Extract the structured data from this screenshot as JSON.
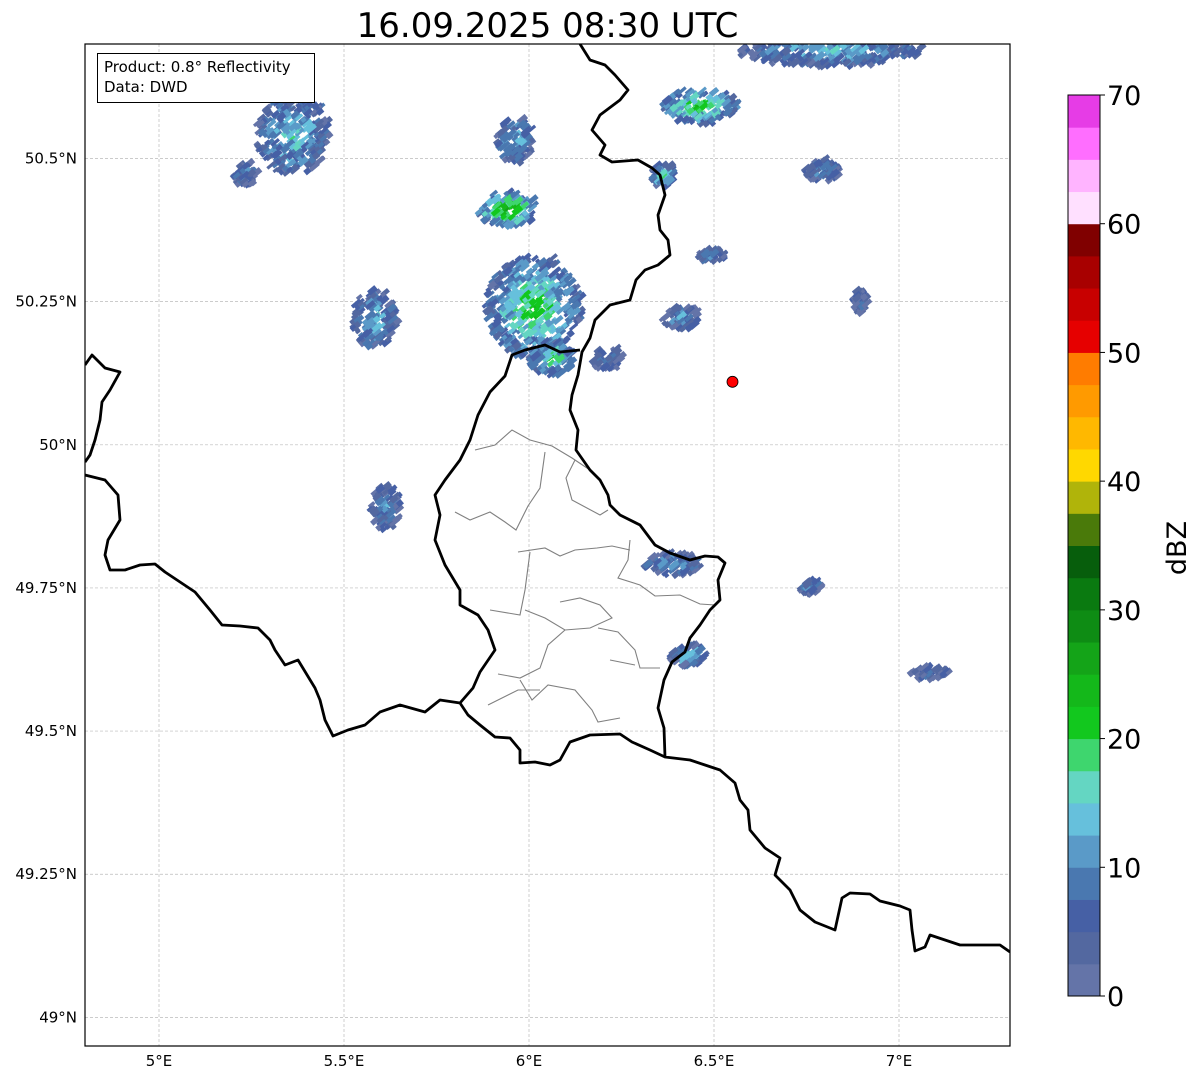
{
  "title": "16.09.2025 08:30 UTC",
  "info": {
    "product": "Product: 0.8° Reflectivity",
    "data_source": "Data: DWD"
  },
  "map": {
    "lon_range": [
      4.8,
      7.3
    ],
    "lat_range": [
      48.95,
      50.7
    ],
    "lat_ticks": [
      {
        "value": 50.5,
        "label": "50.5°N"
      },
      {
        "value": 50.25,
        "label": "50.25°N"
      },
      {
        "value": 50.0,
        "label": "50°N"
      },
      {
        "value": 49.75,
        "label": "49.75°N"
      },
      {
        "value": 49.5,
        "label": "49.5°N"
      },
      {
        "value": 49.25,
        "label": "49.25°N"
      },
      {
        "value": 49.0,
        "label": "49°N"
      }
    ],
    "lon_ticks": [
      {
        "value": 5.0,
        "label": "5°E"
      },
      {
        "value": 5.5,
        "label": "5.5°E"
      },
      {
        "value": 6.0,
        "label": "6°E"
      },
      {
        "value": 6.5,
        "label": "6.5°E"
      },
      {
        "value": 7.0,
        "label": "7°E"
      }
    ],
    "gridlines": true,
    "marker": {
      "lon": 6.55,
      "lat": 50.11,
      "color": "#ff0000"
    }
  },
  "colorbar": {
    "label": "dBZ",
    "min": 0,
    "max": 70,
    "ticks": [
      "0",
      "10",
      "20",
      "30",
      "40",
      "50",
      "60",
      "70"
    ],
    "colors": [
      "#6474a8",
      "#5368a0",
      "#4660a5",
      "#4a78b0",
      "#5a9ac8",
      "#66c0dc",
      "#64d6c2",
      "#3ed66e",
      "#12c81e",
      "#14b81a",
      "#14a418",
      "#0e8c14",
      "#0a7a10",
      "#075e0c",
      "#4a7a0a",
      "#b0b40a",
      "#ffd800",
      "#ffb800",
      "#ff9a00",
      "#ff7c00",
      "#e60000",
      "#c80000",
      "#a80000",
      "#800000",
      "#ffe0ff",
      "#ffb4ff",
      "#ff6eff",
      "#e63ce6"
    ]
  },
  "echoes": [
    {
      "lon": 6.0,
      "lat": 50.24,
      "rlon": 0.13,
      "rlat": 0.09,
      "dbz": 22
    },
    {
      "lon": 6.05,
      "lat": 50.15,
      "rlon": 0.06,
      "rlat": 0.03,
      "dbz": 20
    },
    {
      "lon": 5.93,
      "lat": 50.41,
      "rlon": 0.08,
      "rlat": 0.03,
      "dbz": 28
    },
    {
      "lon": 6.45,
      "lat": 50.59,
      "rlon": 0.1,
      "rlat": 0.03,
      "dbz": 24
    },
    {
      "lon": 5.35,
      "lat": 50.54,
      "rlon": 0.1,
      "rlat": 0.07,
      "dbz": 16
    },
    {
      "lon": 5.57,
      "lat": 50.22,
      "rlon": 0.06,
      "rlat": 0.05,
      "dbz": 14
    },
    {
      "lon": 5.95,
      "lat": 50.53,
      "rlon": 0.05,
      "rlat": 0.04,
      "dbz": 14
    },
    {
      "lon": 6.8,
      "lat": 50.69,
      "rlon": 0.25,
      "rlat": 0.03,
      "dbz": 14
    },
    {
      "lon": 6.42,
      "lat": 49.63,
      "rlon": 0.05,
      "rlat": 0.02,
      "dbz": 15
    },
    {
      "lon": 6.38,
      "lat": 49.79,
      "rlon": 0.08,
      "rlat": 0.02,
      "dbz": 12
    },
    {
      "lon": 5.6,
      "lat": 49.89,
      "rlon": 0.04,
      "rlat": 0.04,
      "dbz": 10
    },
    {
      "lon": 6.78,
      "lat": 50.48,
      "rlon": 0.05,
      "rlat": 0.02,
      "dbz": 12
    },
    {
      "lon": 6.35,
      "lat": 50.47,
      "rlon": 0.03,
      "rlat": 0.02,
      "dbz": 18
    },
    {
      "lon": 7.07,
      "lat": 49.6,
      "rlon": 0.05,
      "rlat": 0.01,
      "dbz": 8
    },
    {
      "lon": 6.75,
      "lat": 49.75,
      "rlon": 0.03,
      "rlat": 0.01,
      "dbz": 10
    },
    {
      "lon": 6.48,
      "lat": 50.33,
      "rlon": 0.04,
      "rlat": 0.01,
      "dbz": 12
    },
    {
      "lon": 6.4,
      "lat": 50.22,
      "rlon": 0.05,
      "rlat": 0.02,
      "dbz": 12
    },
    {
      "lon": 5.22,
      "lat": 50.47,
      "rlon": 0.03,
      "rlat": 0.02,
      "dbz": 10
    },
    {
      "lon": 6.2,
      "lat": 50.15,
      "rlon": 0.04,
      "rlat": 0.02,
      "dbz": 8
    },
    {
      "lon": 6.88,
      "lat": 50.25,
      "rlon": 0.02,
      "rlat": 0.02,
      "dbz": 8
    }
  ]
}
